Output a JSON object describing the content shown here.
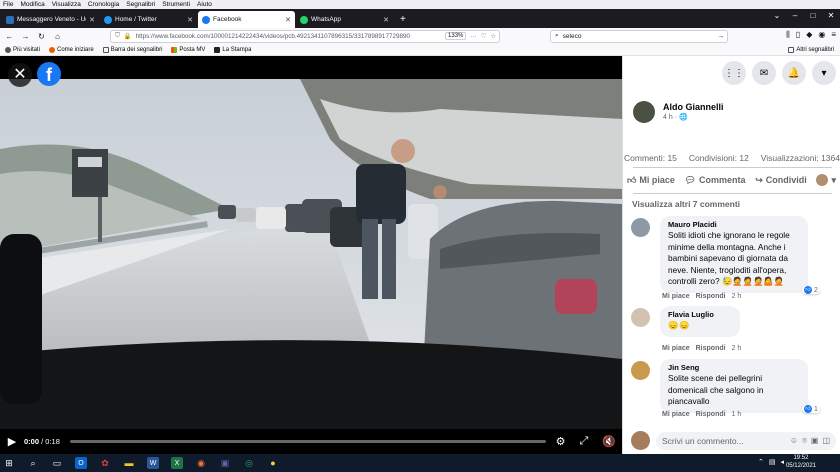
{
  "menubar": [
    "File",
    "Modifica",
    "Visualizza",
    "Cronologia",
    "Segnalibri",
    "Strumenti",
    "Aiuto"
  ],
  "tabs": [
    {
      "title": "Messaggero Veneto - Udine",
      "color": "#2c6fb5",
      "active": false
    },
    {
      "title": "Home / Twitter",
      "color": "#1d9bf0",
      "active": false
    },
    {
      "title": "Facebook",
      "color": "#1877f2",
      "active": true
    },
    {
      "title": "WhatsApp",
      "color": "#25d366",
      "active": false
    }
  ],
  "nav": {
    "url": "https://www.facebook.com/100001214222434/videos/pcb.4921341107896315/3317898917729890",
    "zoom": "133%",
    "search": "seleco"
  },
  "bookmarks": [
    "Più visitati",
    "Come iniziare",
    "Barra dei segnalibri",
    "Posta MV",
    "La Stampa"
  ],
  "bookmarks_other": "Altri segnalibri",
  "video": {
    "time_current": "0:00",
    "time_total": "/ 0:18"
  },
  "post": {
    "author": "Aldo Giannelli",
    "time": "4 h · 🌐",
    "stats": {
      "comments": "Commenti: 15",
      "shares": "Condivisioni: 12",
      "views": "Visualizzazioni: 1364"
    },
    "actions": {
      "like": "Mi piace",
      "comment": "Commenta",
      "share": "Condividi"
    },
    "show_more": "Visualizza altri 7 commenti"
  },
  "comments": [
    {
      "name": "Mauro Placidi",
      "text": "Soliti idioti che ignorano le regole minime della montagna. Anche i bambini sapevano di giornata da neve. Niente, trogloditi all'opera, controlli zero? 😓🤦🤦🤦🤷🤦",
      "like": "Mi piace",
      "reply": "Rispondi",
      "time": "2 h",
      "reactions": "2"
    },
    {
      "name": "Flavia Luglio",
      "text": "😞😞",
      "like": "Mi piace",
      "reply": "Rispondi",
      "time": "2 h"
    },
    {
      "name": "Jin Seng",
      "text": "Solite scene dei pellegrini domenicali che salgono in piancavallo",
      "like": "Mi piace",
      "reply": "Rispondi",
      "time": "1 h",
      "reactions": "1"
    }
  ],
  "write_placeholder": "Scrivi un commento...",
  "clock": {
    "time": "19:52",
    "date": "05/12/2021"
  }
}
